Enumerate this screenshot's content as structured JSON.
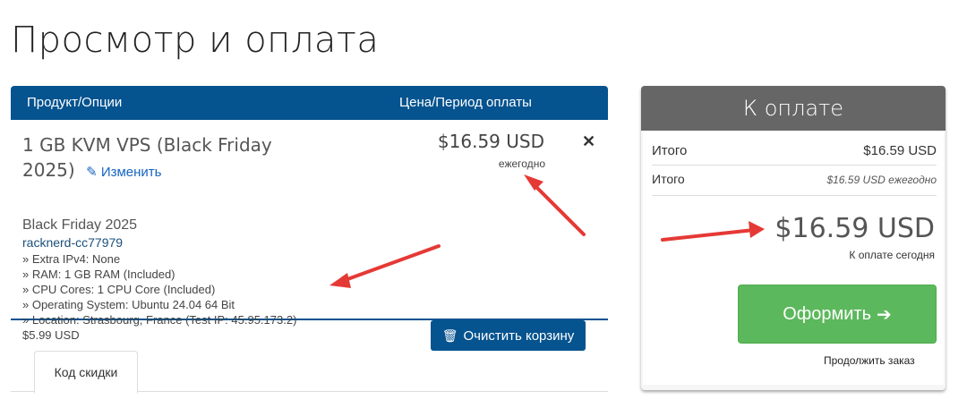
{
  "page": {
    "title": "Просмотр и оплата"
  },
  "cart": {
    "header": {
      "product": "Продукт/Опции",
      "price": "Цена/Период оплаты"
    },
    "item": {
      "name": "1 GB KVM VPS (Black Friday 2025)",
      "edit_label": "Изменить",
      "group": "Black Friday 2025",
      "domain": "racknerd-cc77979",
      "options": [
        "» Extra IPv4: None",
        "» RAM: 1 GB RAM (Included)",
        "» CPU Cores: 1 CPU Core (Included)",
        "» Operating System: Ubuntu 24.04 64 Bit",
        "» Location: Strasbourg, France (Test IP: 45.95.173.2)"
      ],
      "setup_price": "$5.99 USD",
      "price": "$16.59 USD",
      "cycle": "ежегодно",
      "remove_icon": "close-icon"
    },
    "empty_button": "Очистить корзину",
    "promo_tab": "Код скидки"
  },
  "summary": {
    "title": "К оплате",
    "subtotal_label": "Итого",
    "subtotal_value": "$16.59 USD",
    "total_label": "Итого",
    "total_value": "$16.59 USD ежегодно",
    "due_amount": "$16.59 USD",
    "due_label": "К оплате сегодня",
    "checkout_button": "Оформить",
    "continue_link": "Продолжить заказ"
  },
  "colors": {
    "header_blue": "#05538f",
    "checkout_green": "#5cb85c",
    "summary_header": "#666666",
    "arrow_red": "#e53935"
  }
}
